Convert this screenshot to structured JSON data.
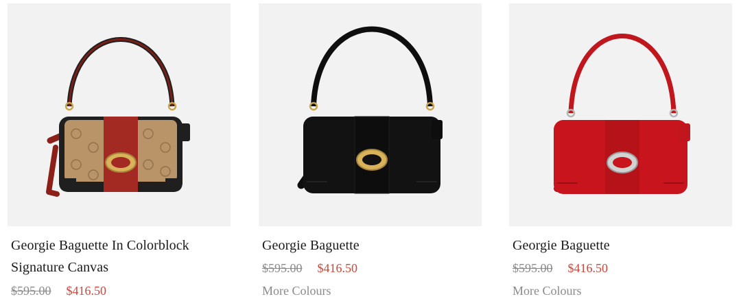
{
  "products": [
    {
      "name": "Georgie Baguette In Colorblock Signature Canvas",
      "original_price": "$595.00",
      "sale_price": "$416.50",
      "more_colours": "",
      "bag_colors": {
        "body": "#b89468",
        "stripe": "#a22a22",
        "trim": "#1f1f1f",
        "strap": "#7a1e18",
        "hardware": "gold"
      }
    },
    {
      "name": "Georgie Baguette",
      "original_price": "$595.00",
      "sale_price": "$416.50",
      "more_colours": "More Colours",
      "bag_colors": {
        "body": "#121212",
        "stripe": "#0d0d0d",
        "trim": "#0a0a0a",
        "strap": "#0e0e0e",
        "hardware": "gold"
      }
    },
    {
      "name": "Georgie Baguette",
      "original_price": "$595.00",
      "sale_price": "$416.50",
      "more_colours": "More Colours",
      "bag_colors": {
        "body": "#c8141c",
        "stripe": "#b51219",
        "trim": "#a80f16",
        "strap": "#c0161d",
        "hardware": "silver"
      }
    }
  ],
  "colors": {
    "image_background": "#f2f2f2",
    "sale_price": "#d0453a",
    "muted_text": "#8a8a8a",
    "product_name": "#1a1a1a"
  }
}
